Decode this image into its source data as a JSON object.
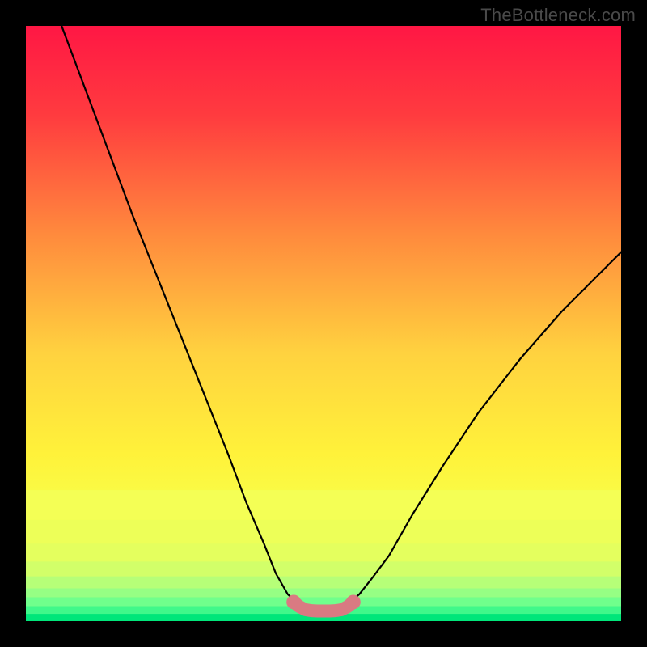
{
  "watermark": "TheBottleneck.com",
  "chart_data": {
    "type": "line",
    "title": "",
    "xlabel": "",
    "ylabel": "",
    "xlim": [
      0,
      100
    ],
    "ylim": [
      0,
      100
    ],
    "grid": false,
    "legend": false,
    "series": [
      {
        "name": "black-left",
        "color": "#000000",
        "x": [
          6,
          9,
          12,
          15,
          18,
          22,
          26,
          30,
          34,
          37,
          40,
          42,
          44,
          46
        ],
        "y": [
          100,
          92,
          84,
          76,
          68,
          58,
          48,
          38,
          28,
          20,
          13,
          8,
          4.5,
          2.8
        ]
      },
      {
        "name": "black-right",
        "color": "#000000",
        "x": [
          54,
          56,
          58,
          61,
          65,
          70,
          76,
          83,
          90,
          97,
          100
        ],
        "y": [
          2.8,
          4.5,
          7,
          11,
          18,
          26,
          35,
          44,
          52,
          59,
          62
        ]
      },
      {
        "name": "pink-bottom",
        "color": "#d97a82",
        "x": [
          45,
          46,
          47,
          48,
          49,
          50,
          51,
          52,
          53,
          54,
          55
        ],
        "y": [
          3.2,
          2.4,
          1.9,
          1.75,
          1.7,
          1.7,
          1.7,
          1.75,
          1.9,
          2.4,
          3.2
        ]
      }
    ],
    "gradient_stops": [
      {
        "offset": 0.0,
        "color": "#ff1744"
      },
      {
        "offset": 0.15,
        "color": "#ff3b3f"
      },
      {
        "offset": 0.35,
        "color": "#ff8a3d"
      },
      {
        "offset": 0.55,
        "color": "#ffd23f"
      },
      {
        "offset": 0.72,
        "color": "#fff23a"
      },
      {
        "offset": 0.82,
        "color": "#f7ff4a"
      },
      {
        "offset": 0.9,
        "color": "#d8ff66"
      },
      {
        "offset": 0.95,
        "color": "#8cff88"
      },
      {
        "offset": 1.0,
        "color": "#00e67a"
      }
    ],
    "bottom_bands": [
      {
        "y0": 0.78,
        "y1": 0.83,
        "color": "#f4ff55"
      },
      {
        "y0": 0.83,
        "y1": 0.87,
        "color": "#edff58"
      },
      {
        "y0": 0.87,
        "y1": 0.9,
        "color": "#e4ff5e"
      },
      {
        "y0": 0.9,
        "y1": 0.925,
        "color": "#d2ff69"
      },
      {
        "y0": 0.925,
        "y1": 0.945,
        "color": "#b6ff78"
      },
      {
        "y0": 0.945,
        "y1": 0.96,
        "color": "#96ff84"
      },
      {
        "y0": 0.96,
        "y1": 0.975,
        "color": "#70ff8c"
      },
      {
        "y0": 0.975,
        "y1": 0.988,
        "color": "#40f88a"
      },
      {
        "y0": 0.988,
        "y1": 1.0,
        "color": "#00e67a"
      }
    ]
  }
}
